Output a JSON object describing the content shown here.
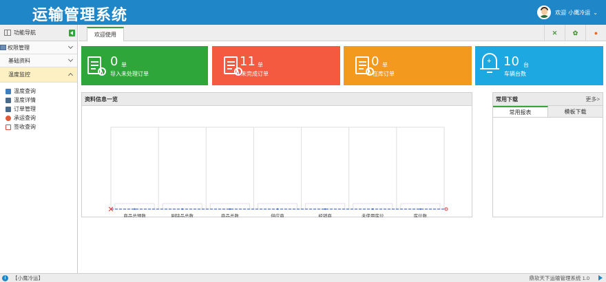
{
  "header": {
    "title": "运输管理系统",
    "welcome": "欢迎",
    "username": "小鹰冷运"
  },
  "sidebar": {
    "title": "功能导航",
    "groups": [
      {
        "label": "权限管理"
      },
      {
        "label": "基础资料"
      },
      {
        "label": "温度监控"
      }
    ],
    "items": [
      {
        "label": "温度查询",
        "icon": "chart-icon"
      },
      {
        "label": "温度详情",
        "icon": "monitor-icon"
      },
      {
        "label": "订单管理",
        "icon": "monitor-icon"
      },
      {
        "label": "承运查询",
        "icon": "truck-icon"
      },
      {
        "label": "签收查询",
        "icon": "document-icon"
      }
    ]
  },
  "tabs": {
    "active": "欢迎使用"
  },
  "cards": [
    {
      "value": "0",
      "unit": "单",
      "caption": "导入未处理订单",
      "color": "#2ea63a"
    },
    {
      "value": "11",
      "unit": "单",
      "caption": "未完成订单",
      "color": "#f35a3f"
    },
    {
      "value": "0",
      "unit": "单",
      "caption": "在库订单",
      "color": "#f39a1e"
    },
    {
      "value": "10",
      "unit": "台",
      "caption": "车辆台数",
      "color": "#1da8e2"
    }
  ],
  "panel": {
    "title": "资料信息一览"
  },
  "chart_data": {
    "type": "line",
    "categories": [
      "商品总预数",
      "剔除品总数",
      "商品总数",
      "供应商",
      "经销商",
      "未使用库位",
      "库位数"
    ],
    "values": [
      0,
      0,
      0,
      0,
      0,
      0,
      0
    ],
    "colors": {
      "line": "#4a6fd1",
      "marker": "#e33"
    }
  },
  "downloads": {
    "title": "常用下载",
    "more": "更多>",
    "tabs": [
      "常用报表",
      "模板下载"
    ]
  },
  "footer": {
    "user": "【小鹰冷运】",
    "system": "鼎软天下运输管理系统 1.0"
  }
}
